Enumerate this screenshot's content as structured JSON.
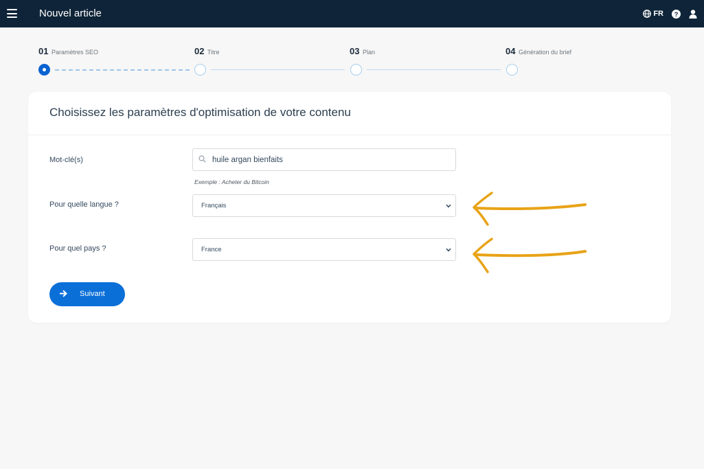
{
  "header": {
    "title": "Nouvel article",
    "language": "FR",
    "background": "#0f2438"
  },
  "stepper": {
    "steps": [
      {
        "number": "01",
        "label": "Paramètres SEO",
        "state": "active"
      },
      {
        "number": "02",
        "label": "Titre",
        "state": "pending"
      },
      {
        "number": "03",
        "label": "Plan",
        "state": "pending"
      },
      {
        "number": "04",
        "label": "Génération du brief",
        "state": "pending"
      }
    ],
    "accent": "#0b63d1"
  },
  "card": {
    "title": "Choisissez les paramètres d'optimisation de votre contenu",
    "keyword": {
      "label": "Mot-clé(s)",
      "value": "huile argan bienfaits",
      "hint": "Exemple : Acheter du Bitcoin"
    },
    "language": {
      "label": "Pour quelle langue ?",
      "value": "Français"
    },
    "country": {
      "label": "Pour quel pays ?",
      "value": "France"
    },
    "next_button": "Suivant",
    "button_color": "#0b6fd8"
  },
  "annotations": {
    "arrow_color": "#e8a317",
    "icon": "hand-drawn-arrow-left-icon"
  }
}
